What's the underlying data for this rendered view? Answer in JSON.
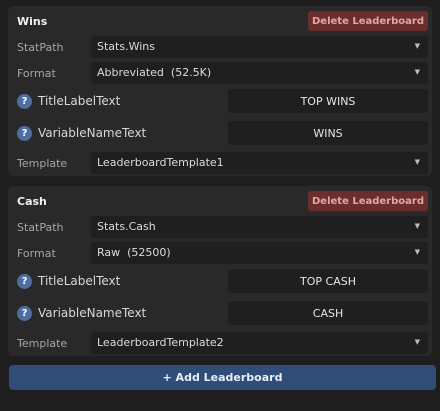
{
  "leaderboards": [
    {
      "title": "Wins",
      "delete_label": "Delete Leaderboard",
      "stat_path_label": "StatPath",
      "stat_path_value": "Stats.Wins",
      "format_label": "Format",
      "format_value": "Abbreviated  (52.5K)",
      "title_label_text_label": "TitleLabelText",
      "title_label_text_value": "TOP WINS",
      "variable_name_text_label": "VariableNameText",
      "variable_name_text_value": "WINS",
      "template_label": "Template",
      "template_value": "LeaderboardTemplate1"
    },
    {
      "title": "Cash",
      "delete_label": "Delete Leaderboard",
      "stat_path_label": "StatPath",
      "stat_path_value": "Stats.Cash",
      "format_label": "Format",
      "format_value": "Raw  (52500)",
      "title_label_text_label": "TitleLabelText",
      "title_label_text_value": "TOP CASH",
      "variable_name_text_label": "VariableNameText",
      "variable_name_text_value": "CASH",
      "template_label": "Template",
      "template_value": "LeaderboardTemplate2"
    }
  ],
  "help_glyph": "?",
  "dropdown_caret": "▼",
  "add_button_label": "+ Add Leaderboard",
  "icons": {
    "help": "help-icon",
    "caret": "chevron-down-icon"
  },
  "colors": {
    "background": "#1e1e1e",
    "panel": "#292929",
    "field": "#1f1f1f",
    "delete_button": "#6b2e2e",
    "delete_text": "#e8a4a4",
    "add_button": "#2f4d77",
    "help_icon": "#4a6fa0"
  }
}
